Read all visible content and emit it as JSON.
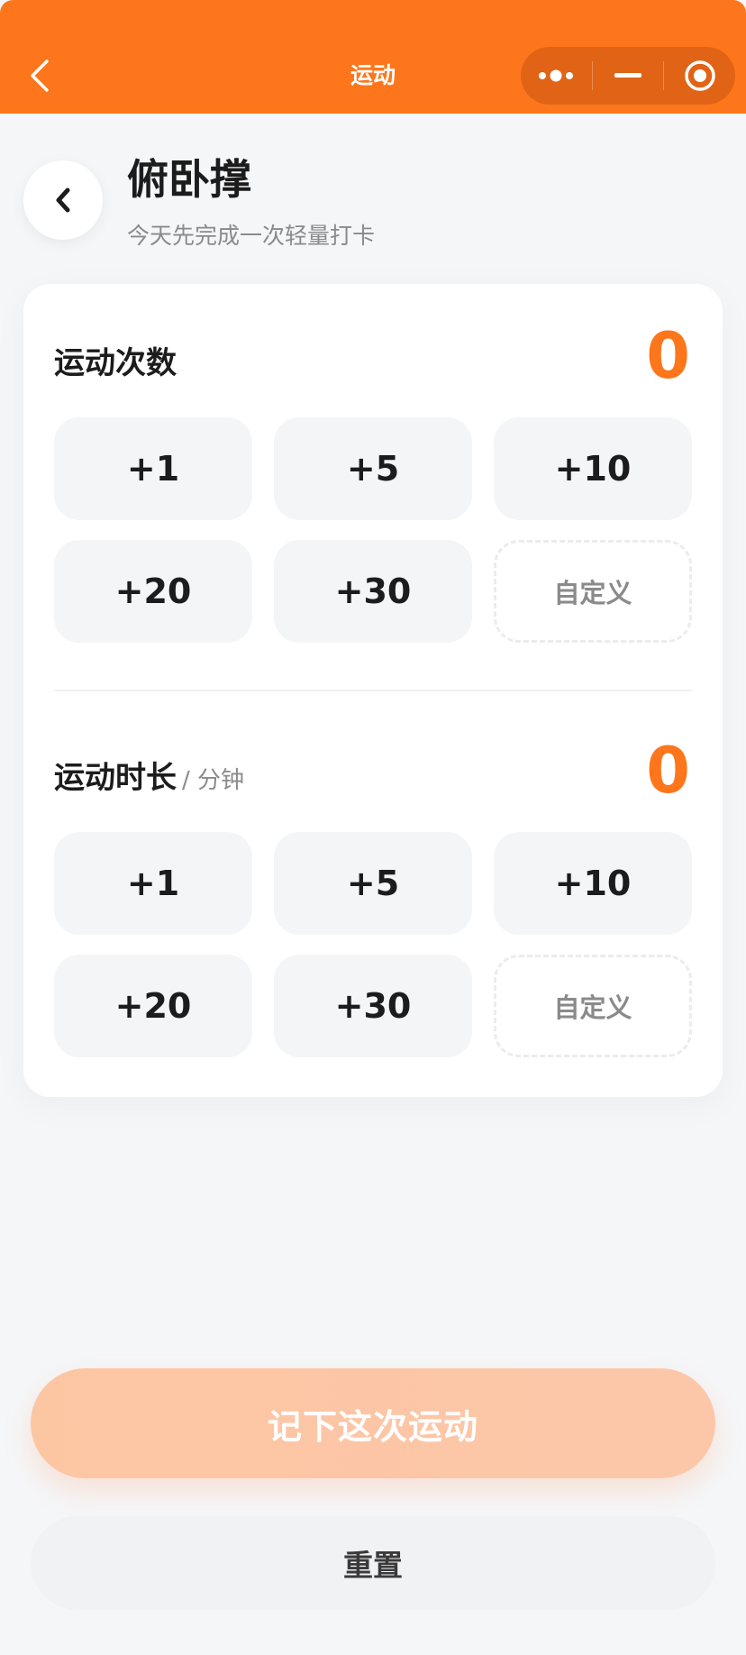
{
  "navbar": {
    "title": "运动",
    "back_icon": "chevron-left-icon",
    "capsule": {
      "more_icon": "more-dots-icon",
      "minimize_icon": "minus-icon",
      "close_icon": "target-circle-icon"
    },
    "background_color": "#fd761b"
  },
  "header": {
    "back_icon": "chevron-left-icon",
    "title": "俯卧撑",
    "subtitle": "今天先完成一次轻量打卡"
  },
  "count_section": {
    "label": "运动次数",
    "value": "0",
    "buttons": [
      "+1",
      "+5",
      "+10",
      "+20",
      "+30"
    ],
    "custom_label": "自定义"
  },
  "duration_section": {
    "label": "运动时长",
    "unit": "/ 分钟",
    "value": "0",
    "buttons": [
      "+1",
      "+5",
      "+10",
      "+20",
      "+30"
    ],
    "custom_label": "自定义"
  },
  "actions": {
    "submit_label": "记下这次运动",
    "reset_label": "重置"
  },
  "colors": {
    "accent": "#fd761b",
    "submit_disabled": "#fdc6a3"
  }
}
